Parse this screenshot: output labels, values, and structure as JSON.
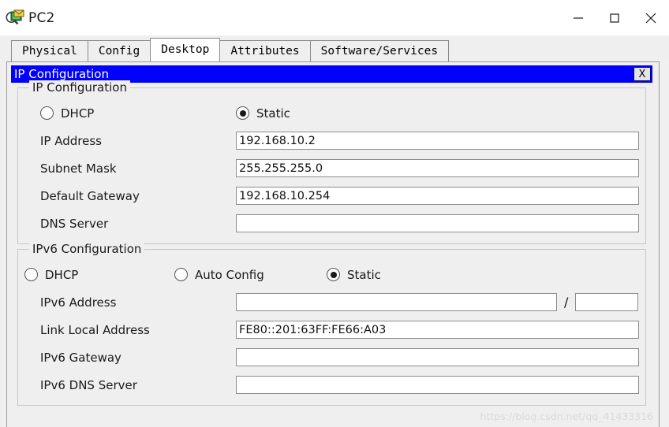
{
  "window": {
    "title": "PC2",
    "icon": "pc-device-icon",
    "controls": {
      "minimize": "minimize-icon",
      "maximize": "maximize-icon",
      "close": "close-icon"
    }
  },
  "tabs": [
    {
      "label": "Physical",
      "active": false
    },
    {
      "label": "Config",
      "active": false
    },
    {
      "label": "Desktop",
      "active": true
    },
    {
      "label": "Attributes",
      "active": false
    },
    {
      "label": "Software/Services",
      "active": false
    }
  ],
  "dialog": {
    "title": "IP Configuration",
    "close_label": "X",
    "ipv4": {
      "group_title": "IP Configuration",
      "mode_options": [
        {
          "label": "DHCP",
          "selected": false
        },
        {
          "label": "Static",
          "selected": true
        }
      ],
      "fields": [
        {
          "label": "IP Address",
          "value": "192.168.10.2",
          "placeholder": ""
        },
        {
          "label": "Subnet Mask",
          "value": "255.255.255.0",
          "placeholder": ""
        },
        {
          "label": "Default Gateway",
          "value": "192.168.10.254",
          "placeholder": ""
        },
        {
          "label": "DNS Server",
          "value": "",
          "placeholder": ""
        }
      ]
    },
    "ipv6": {
      "group_title": "IPv6 Configuration",
      "mode_options": [
        {
          "label": "DHCP",
          "selected": false
        },
        {
          "label": "Auto Config",
          "selected": false
        },
        {
          "label": "Static",
          "selected": true
        }
      ],
      "address_row": {
        "label": "IPv6 Address",
        "value": "",
        "separator": "/",
        "prefix_value": ""
      },
      "fields": [
        {
          "label": "Link Local Address",
          "value": "FE80::201:63FF:FE66:A03",
          "placeholder": ""
        },
        {
          "label": "IPv6 Gateway",
          "value": "",
          "placeholder": ""
        },
        {
          "label": "IPv6 DNS Server",
          "value": "",
          "placeholder": ""
        }
      ]
    }
  },
  "watermark": "https://blog.csdn.net/qq_41433316",
  "colors": {
    "dialog_titlebar": "#0000ff",
    "dialog_title_text": "#ffffff",
    "panel_background": "#efefef",
    "input_background": "#ffffff"
  }
}
